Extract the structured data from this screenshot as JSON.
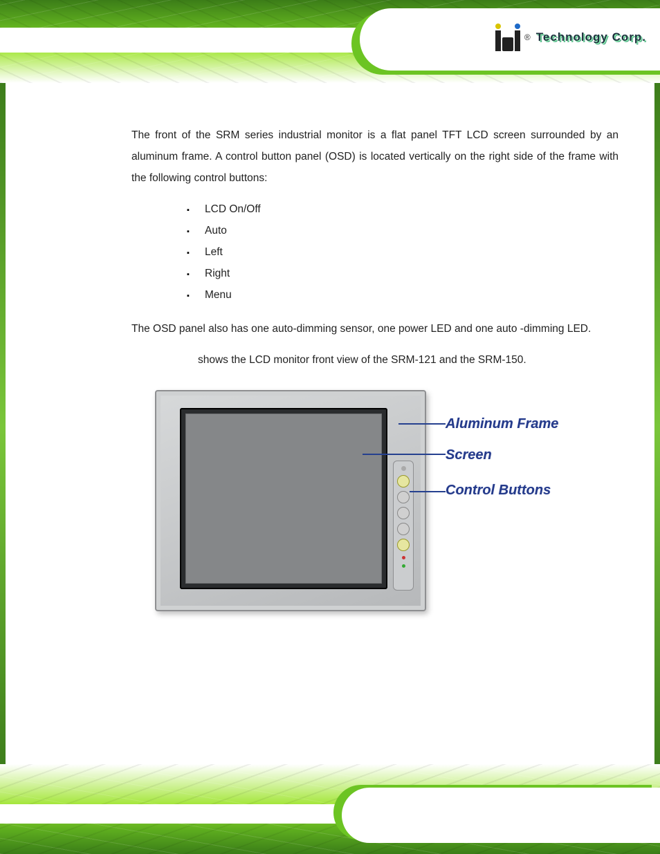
{
  "header": {
    "brand_text": "Technology Corp.",
    "registered_mark": "®"
  },
  "body": {
    "intro": "The front of the SRM series industrial monitor is a flat panel TFT LCD screen surrounded by an aluminum frame. A control button panel (OSD) is located vertically on the right side of the frame with the following control buttons:",
    "buttons": [
      "LCD On/Off",
      "Auto",
      "Left",
      "Right",
      "Menu"
    ],
    "osd_note": "The OSD panel also has one auto-dimming sensor, one power LED and one auto -dimming LED.",
    "figure_lead_in": "shows the LCD monitor front view of the SRM-121 and the SRM-150."
  },
  "figure": {
    "callouts": [
      "Aluminum Frame",
      "Screen",
      "Control Buttons"
    ]
  }
}
